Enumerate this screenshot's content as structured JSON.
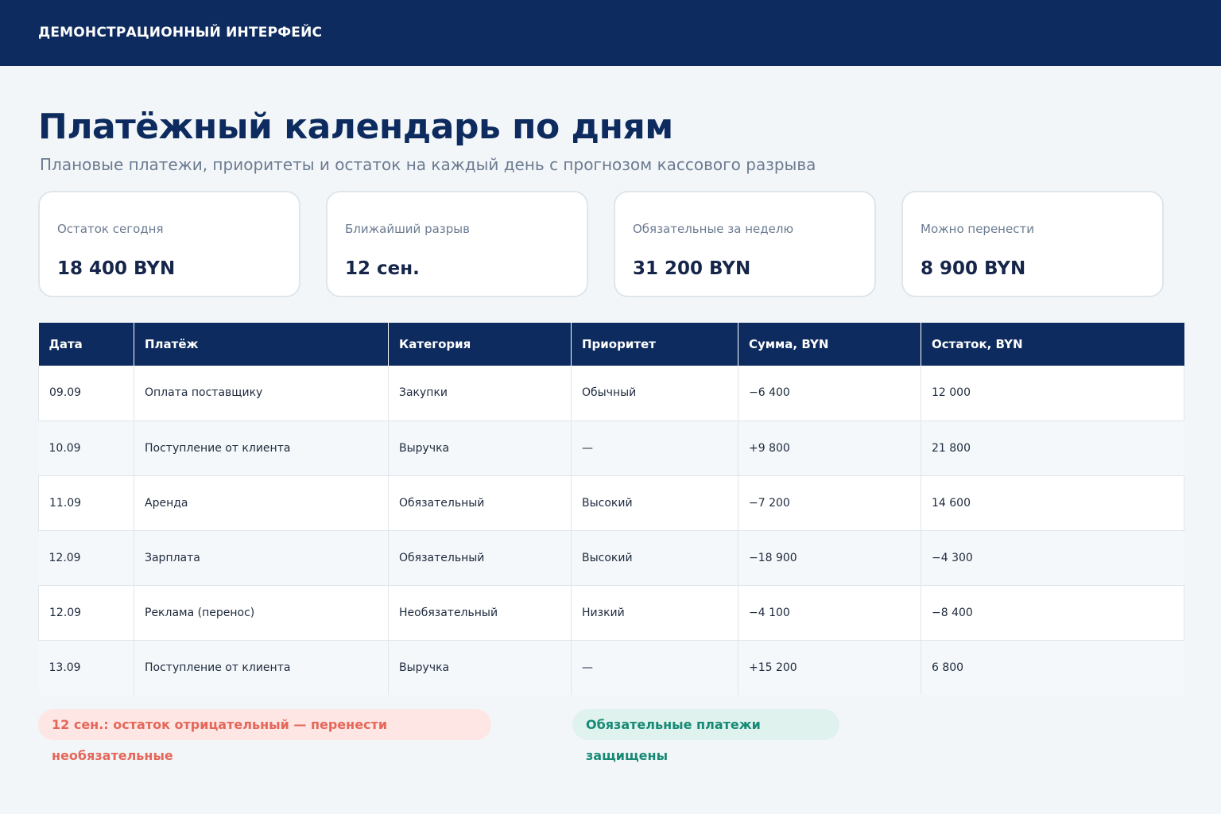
{
  "header": {
    "brand": "ДЕМОНСТРАЦИОННЫЙ ИНТЕРФЕЙС"
  },
  "page": {
    "title": "Платёжный календарь по дням",
    "subtitle": "Плановые платежи, приоритеты и остаток на каждый день с прогнозом кассового разрыва"
  },
  "kpis": [
    {
      "label": "Остаток сегодня",
      "value": "18 400 BYN"
    },
    {
      "label": "Ближайший разрыв",
      "value": "12 сен."
    },
    {
      "label": "Обязательные за неделю",
      "value": "31 200 BYN"
    },
    {
      "label": "Можно перенести",
      "value": "8 900 BYN"
    }
  ],
  "table": {
    "columns": [
      "Дата",
      "Платёж",
      "Категория",
      "Приоритет",
      "Сумма, BYN",
      "Остаток, BYN"
    ],
    "rows": [
      [
        "09.09",
        "Оплата поставщику",
        "Закупки",
        "Обычный",
        "−6 400",
        "12 000"
      ],
      [
        "10.09",
        "Поступление от клиента",
        "Выручка",
        "—",
        "+9 800",
        "21 800"
      ],
      [
        "11.09",
        "Аренда",
        "Обязательный",
        "Высокий",
        "−7 200",
        "14 600"
      ],
      [
        "12.09",
        "Зарплата",
        "Обязательный",
        "Высокий",
        "−18 900",
        "−4 300"
      ],
      [
        "12.09",
        "Реклама (перенос)",
        "Необязательный",
        "Низкий",
        "−4 100",
        "−8 400"
      ],
      [
        "13.09",
        "Поступление от клиента",
        "Выручка",
        "—",
        "+15 200",
        "6 800"
      ]
    ]
  },
  "alerts": {
    "warning": "12 сен.: остаток отрицательный — перенести необязательные",
    "ok": "Обязательные платежи защищены"
  },
  "colors": {
    "header_bg": "#0d2b5e",
    "page_bg": "#f3f6f8",
    "warning_bg": "#fde6e3",
    "warning_text": "#e5675a",
    "ok_bg": "#dff2ee",
    "ok_text": "#178a75"
  }
}
